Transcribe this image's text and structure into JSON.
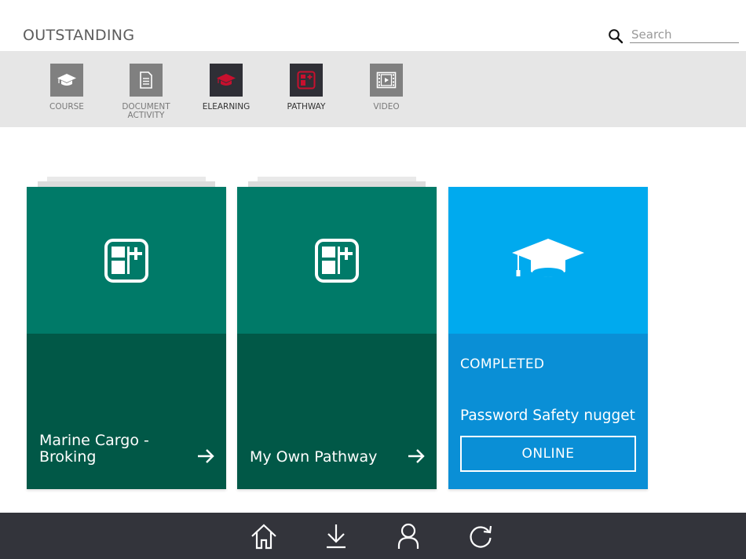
{
  "header": {
    "title": "OUTSTANDING",
    "search_placeholder": "Search"
  },
  "filters": [
    {
      "label": "COURSE",
      "icon": "graduation-cap-icon",
      "active": false
    },
    {
      "label": "DOCUMENT ACTIVITY",
      "icon": "document-icon",
      "active": false
    },
    {
      "label": "ELEARNING",
      "icon": "graduation-cap-icon",
      "active": true
    },
    {
      "label": "PATHWAY",
      "icon": "pathway-icon",
      "active": true
    },
    {
      "label": "VIDEO",
      "icon": "video-icon",
      "active": false
    }
  ],
  "cards": [
    {
      "type": "pathway",
      "icon": "pathway-icon",
      "title": "Marine Cargo - Broking",
      "color": "#007a68"
    },
    {
      "type": "pathway",
      "icon": "pathway-icon",
      "title": "My Own Pathway",
      "color": "#007a68"
    },
    {
      "type": "elearning",
      "icon": "graduation-cap-icon",
      "status": "COMPLETED",
      "title": "Password Safety nugget",
      "button_label": "ONLINE",
      "color": "#00aaee"
    }
  ],
  "toolbar": {
    "items": [
      {
        "icon": "home-icon"
      },
      {
        "icon": "download-icon"
      },
      {
        "icon": "profile-icon"
      },
      {
        "icon": "refresh-icon"
      }
    ]
  },
  "colors": {
    "accent_red": "#c8102e",
    "green_top": "#007a68",
    "green_bottom": "#015847",
    "blue_top": "#00aaee",
    "blue_bottom": "#0a8fd6",
    "toolbar": "#33343b"
  }
}
